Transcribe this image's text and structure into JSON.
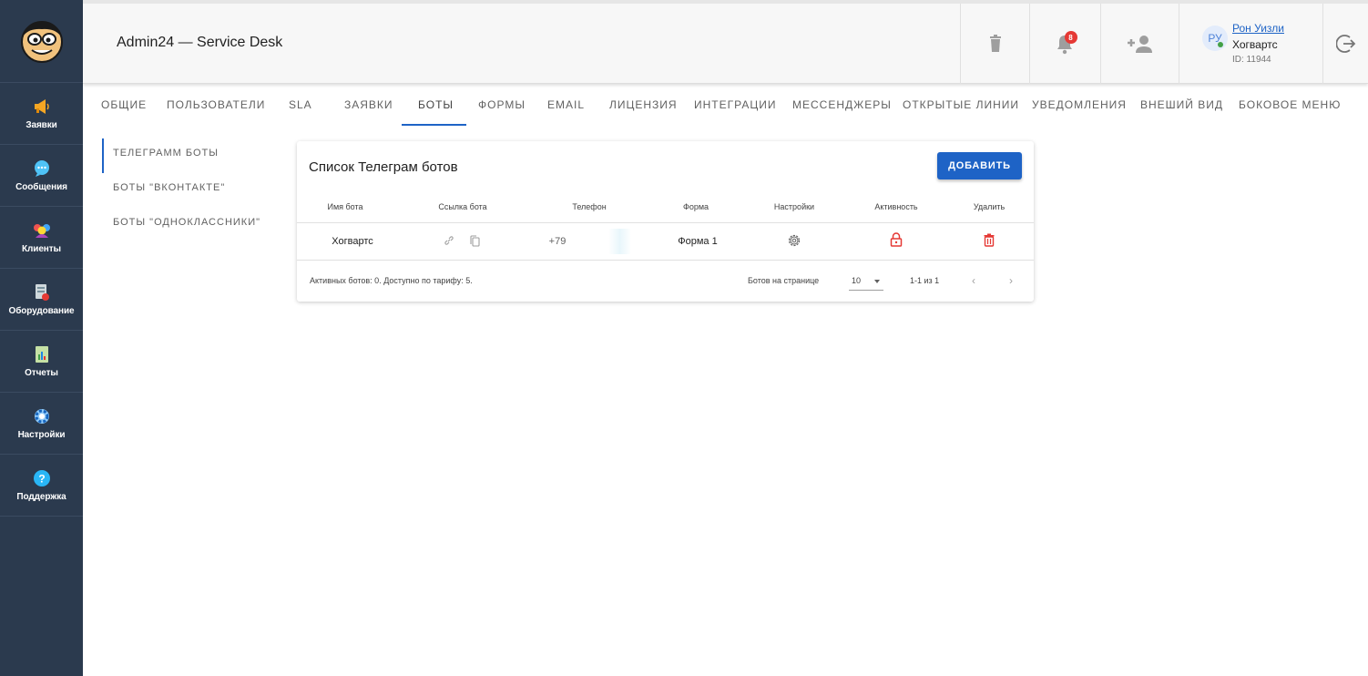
{
  "app": {
    "title": "Admin24 — Service Desk"
  },
  "sidebar": {
    "items": [
      {
        "label": "Заявки",
        "icon": "megaphone-icon"
      },
      {
        "label": "Сообщения",
        "icon": "chat-bubble-icon"
      },
      {
        "label": "Клиенты",
        "icon": "clients-icon"
      },
      {
        "label": "Оборудование",
        "icon": "equipment-icon"
      },
      {
        "label": "Отчеты",
        "icon": "report-icon"
      },
      {
        "label": "Настройки",
        "icon": "gear-icon"
      },
      {
        "label": "Поддержка",
        "icon": "help-icon"
      }
    ]
  },
  "header": {
    "notifications_count": "8",
    "user": {
      "initials": "РУ",
      "name": "Рон Уизли",
      "org": "Хогвартс",
      "id": "ID: 11944"
    }
  },
  "tabs": [
    "ОБЩИЕ",
    "ПОЛЬЗОВАТЕЛИ",
    "SLA",
    "ЗАЯВКИ",
    "БОТЫ",
    "ФОРМЫ",
    "EMAIL",
    "ЛИЦЕНЗИЯ",
    "ИНТЕГРАЦИИ",
    "МЕССЕНДЖЕРЫ",
    "ОТКРЫТЫЕ ЛИНИИ",
    "УВЕДОМЛЕНИЯ",
    "ВНЕШИЙ ВИД",
    "БОКОВОЕ МЕНЮ"
  ],
  "active_tab": "БОТЫ",
  "submenu": [
    "ТЕЛЕГРАММ БОТЫ",
    "БОТЫ \"ВКОНТАКТЕ\"",
    "БОТЫ \"ОДНОКЛАССНИКИ\""
  ],
  "active_submenu": "ТЕЛЕГРАММ БОТЫ",
  "card": {
    "title": "Список Телеграм ботов",
    "add_label": "ДОБАВИТЬ",
    "columns": [
      "Имя бота",
      "Ссылка бота",
      "Телефон",
      "Форма",
      "Настройки",
      "Активность",
      "Удалить"
    ],
    "rows": [
      {
        "name": "Хогвартс",
        "phone": "+79",
        "form": "Форма 1"
      }
    ],
    "footer_info": "Активных ботов: 0. Доступно по тарифу: 5.",
    "rows_per_page_label": "Ботов на странице",
    "rows_per_page": "10",
    "range": "1-1 из 1"
  },
  "colors": {
    "sidebar_bg": "#2b3a4e",
    "accent": "#1e63c6",
    "danger": "#e53935"
  }
}
